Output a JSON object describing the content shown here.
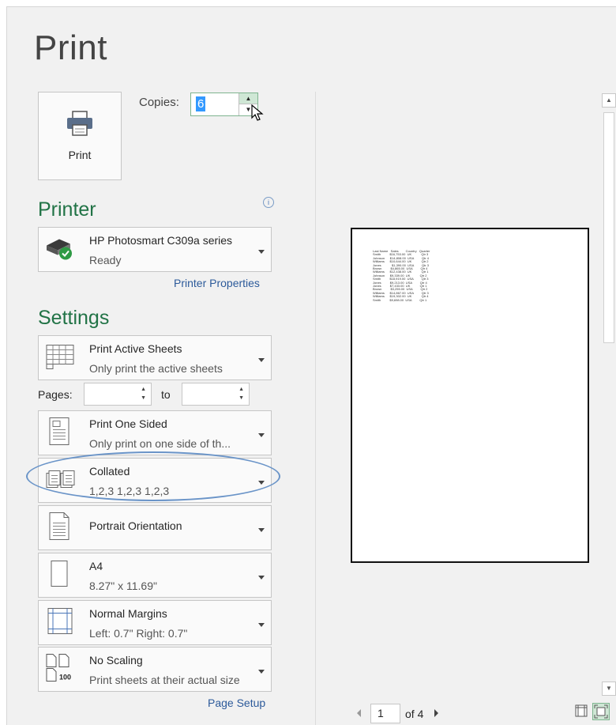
{
  "title": "Print",
  "print_button": {
    "label": "Print"
  },
  "copies": {
    "label": "Copies:",
    "value": "6"
  },
  "printer": {
    "heading": "Printer",
    "info_glyph": "i",
    "name": "HP Photosmart C309a series",
    "status": "Ready",
    "properties_link": "Printer Properties"
  },
  "settings": {
    "heading": "Settings",
    "what": {
      "label": "Print Active Sheets",
      "desc": "Only print the active sheets"
    },
    "pages": {
      "label": "Pages:",
      "to": "to",
      "from_value": "",
      "to_value": ""
    },
    "sides": {
      "label": "Print One Sided",
      "desc": "Only print on one side of th..."
    },
    "collation": {
      "label": "Collated",
      "desc": "1,2,3    1,2,3    1,2,3"
    },
    "orientation": {
      "label": "Portrait Orientation"
    },
    "paper": {
      "label": "A4",
      "desc": "8.27\" x 11.69\""
    },
    "margins": {
      "label": "Normal Margins",
      "desc": "Left:  0.7\"    Right:  0.7\""
    },
    "scaling": {
      "label": "No Scaling",
      "desc": "Print sheets at their actual size",
      "icon_text": "100"
    },
    "page_setup_link": "Page Setup"
  },
  "preview": {
    "rows": [
      "Last Name   Sales        Country   Quarter",
      "Smith          $16,753.00  UK           Qtr 3",
      "Johnson      $14,808.00  USA         Qtr 4",
      "Williams      $10,644.00  UK           Qtr 2",
      "Jones            $1,390.00  USA         Qtr 3",
      "Brown          $4,865.00  USA         Qtr 4",
      "Williams      $12,438.00  UK           Qtr 1",
      "Johnson      $9,339.00  UK           Qtr 2",
      "Smith          $18,919.00  USA         Qtr 3",
      "Jones          $9,213.00  USA         Qtr 4",
      "Jones          $7,433.00  UK           Qtr 1",
      "Brown          $3,255.00  USA         Qtr 2",
      "Williams      $14,867.00  USA         Qtr 3",
      "Williams      $19,302.00  UK           Qtr 4",
      "Smith          $9,698.00  USA         Qtr 1"
    ],
    "current_page": "1",
    "of_pages": "of 4"
  },
  "colors": {
    "accent": "#217346",
    "link": "#2c5a9a",
    "highlight_oval": "#6a94c8"
  },
  "icons": [
    "printer-icon",
    "printer-ready-icon",
    "active-sheets-icon",
    "one-sided-icon",
    "collated-icon",
    "portrait-icon",
    "paper-icon",
    "margins-icon",
    "scaling-icon",
    "show-margins-icon",
    "zoom-to-page-icon"
  ]
}
